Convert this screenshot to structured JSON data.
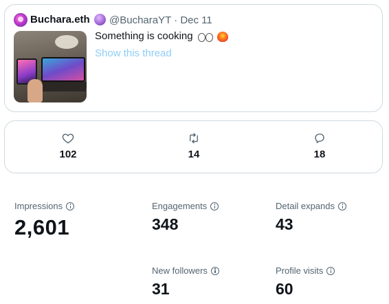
{
  "tweet": {
    "display_name": "Buchara.eth",
    "handle": "@BucharaYT",
    "separator": "·",
    "date": "Dec 11",
    "text": "Something is cooking",
    "show_thread_label": "Show this thread"
  },
  "engagement_bar": {
    "likes": "102",
    "retweets": "14",
    "replies": "18"
  },
  "stats": {
    "impressions": {
      "label": "Impressions",
      "value": "2,601"
    },
    "engagements": {
      "label": "Engagements",
      "value": "348"
    },
    "detail_expands": {
      "label": "Detail expands",
      "value": "43"
    },
    "new_followers": {
      "label": "New followers",
      "value": "31"
    },
    "profile_visits": {
      "label": "Profile visits",
      "value": "60"
    }
  },
  "icons": {
    "like": "heart-icon",
    "retweet": "retweet-icon",
    "reply": "reply-icon",
    "info": "info-icon"
  },
  "colors": {
    "text_primary": "#0f1419",
    "text_secondary": "#536471",
    "link": "#8ecdf8",
    "border": "#cfd9de"
  }
}
